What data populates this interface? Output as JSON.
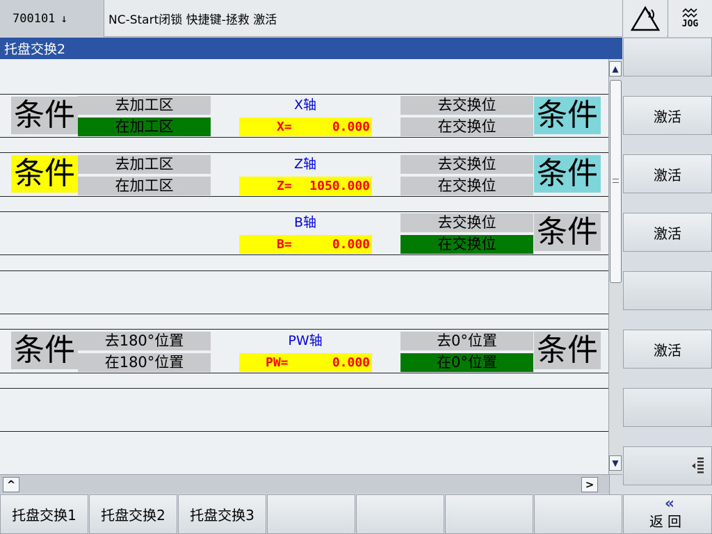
{
  "header": {
    "alarm_code": "700101",
    "alarm_arrow": "↓",
    "alarm_text": "NC-Start闭锁 快捷键-拯救 激活",
    "alarm_icon": "alarm-triangle-icon",
    "mode_label": "JOG"
  },
  "title": "托盘交换2",
  "colors": {
    "title_bg": "#2b54a5",
    "active_green": "#007a00",
    "highlight_yellow": "#ffff00",
    "highlight_cyan": "#7ed6db",
    "axis_name": "#0000e0",
    "axis_value": "#ff0000"
  },
  "rows": {
    "x": {
      "left_cond": "条件",
      "left_top": "去加工区",
      "left_bottom": "在加工区",
      "axis_name": "X轴",
      "axis_label": "X=",
      "axis_value": "0.000",
      "right_top": "去交换位",
      "right_bottom": "在交换位",
      "right_cond": "条件"
    },
    "z": {
      "left_cond": "条件",
      "left_top": "去加工区",
      "left_bottom": "在加工区",
      "axis_name": "Z轴",
      "axis_label": "Z=",
      "axis_value": "1050.000",
      "right_top": "去交换位",
      "right_bottom": "在交换位",
      "right_cond": "条件"
    },
    "b": {
      "axis_name": "B轴",
      "axis_label": "B=",
      "axis_value": "0.000",
      "right_top": "去交换位",
      "right_bottom": "在交换位",
      "right_cond": "条件"
    },
    "pw": {
      "left_cond": "条件",
      "left_top": "去180°位置",
      "left_bottom": "在180°位置",
      "axis_name": "PW轴",
      "axis_label": "PW=",
      "axis_value": "0.000",
      "right_top": "去0°位置",
      "right_bottom": "在0°位置",
      "right_cond": "条件"
    }
  },
  "scroll": {
    "up": "▲",
    "down": "▼",
    "left": "^",
    "right": ">"
  },
  "right_softkeys": [
    "",
    "激活",
    "激活",
    "激活",
    "",
    "激活",
    "",
    ""
  ],
  "bottom_softkeys": [
    "托盘交换1",
    "托盘交换2",
    "托盘交换3",
    "",
    "",
    "",
    ""
  ],
  "back": {
    "chevron": "«",
    "label": "返回"
  }
}
